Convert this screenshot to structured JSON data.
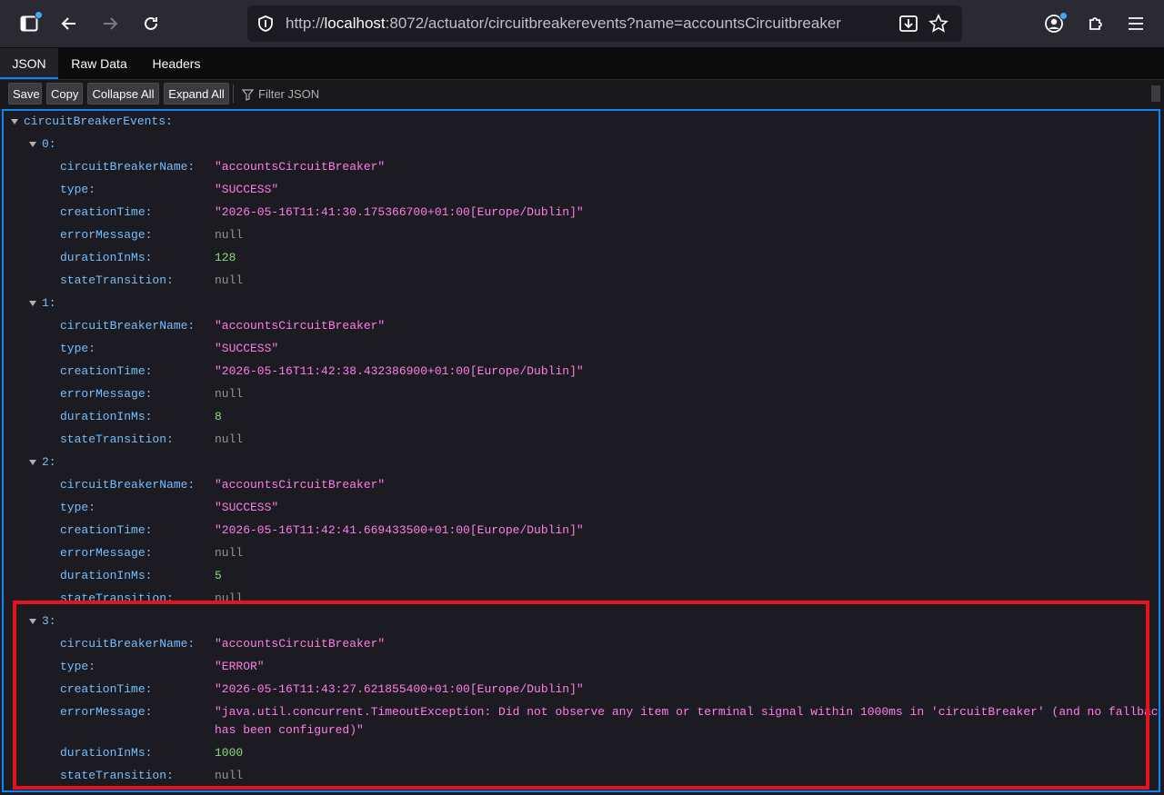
{
  "browser": {
    "url_prefix": "http://",
    "url_host": "localhost",
    "url_rest": ":8072/actuator/circuitbreakerevents?name=accountsCircuitbreaker",
    "icons": {
      "sidebar": "sidebar-icon",
      "back": "back-arrow-icon",
      "forward": "forward-arrow-icon",
      "reload": "reload-icon",
      "shield": "shield-icon",
      "download": "download-icon",
      "bookmark": "star-icon",
      "account": "account-icon",
      "extensions": "puzzle-icon",
      "menu": "hamburger-menu-icon"
    }
  },
  "viewer": {
    "tabs": [
      "JSON",
      "Raw Data",
      "Headers"
    ],
    "active_tab": "JSON",
    "toolbar": {
      "save": "Save",
      "copy": "Copy",
      "collapse_all": "Collapse All",
      "expand_all": "Expand All",
      "filter_placeholder": "Filter JSON"
    }
  },
  "json": {
    "root_key": "circuitBreakerEvents:",
    "events": [
      {
        "index": "0:",
        "circuitBreakerName": "\"accountsCircuitBreaker\"",
        "type": "\"SUCCESS\"",
        "creationTime": "\"2026-05-16T11:41:30.175366700+01:00[Europe/Dublin]\"",
        "errorMessage": "null",
        "durationInMs": "128",
        "stateTransition": "null"
      },
      {
        "index": "1:",
        "circuitBreakerName": "\"accountsCircuitBreaker\"",
        "type": "\"SUCCESS\"",
        "creationTime": "\"2026-05-16T11:42:38.432386900+01:00[Europe/Dublin]\"",
        "errorMessage": "null",
        "durationInMs": "8",
        "stateTransition": "null"
      },
      {
        "index": "2:",
        "circuitBreakerName": "\"accountsCircuitBreaker\"",
        "type": "\"SUCCESS\"",
        "creationTime": "\"2026-05-16T11:42:41.669433500+01:00[Europe/Dublin]\"",
        "errorMessage": "null",
        "durationInMs": "5",
        "stateTransition": "null"
      },
      {
        "index": "3:",
        "circuitBreakerName": "\"accountsCircuitBreaker\"",
        "type": "\"ERROR\"",
        "creationTime": "\"2026-05-16T11:43:27.621855400+01:00[Europe/Dublin]\"",
        "errorMessage_line1": "\"java.util.concurrent.TimeoutException: Did not observe any item or terminal signal within 1000ms in 'circuitBreaker' (and no fallback",
        "errorMessage_line2": "has been configured)\"",
        "durationInMs": "1000",
        "stateTransition": "null"
      }
    ],
    "labels": {
      "circuitBreakerName": "circuitBreakerName:",
      "type": "type:",
      "creationTime": "creationTime:",
      "errorMessage": "errorMessage:",
      "durationInMs": "durationInMs:",
      "stateTransition": "stateTransition:"
    }
  },
  "colors": {
    "key": "#75bfff",
    "string": "#ff7de9",
    "number": "#86de74",
    "null": "#939395",
    "accent": "#0a84ff",
    "highlight": "#e3141b"
  }
}
